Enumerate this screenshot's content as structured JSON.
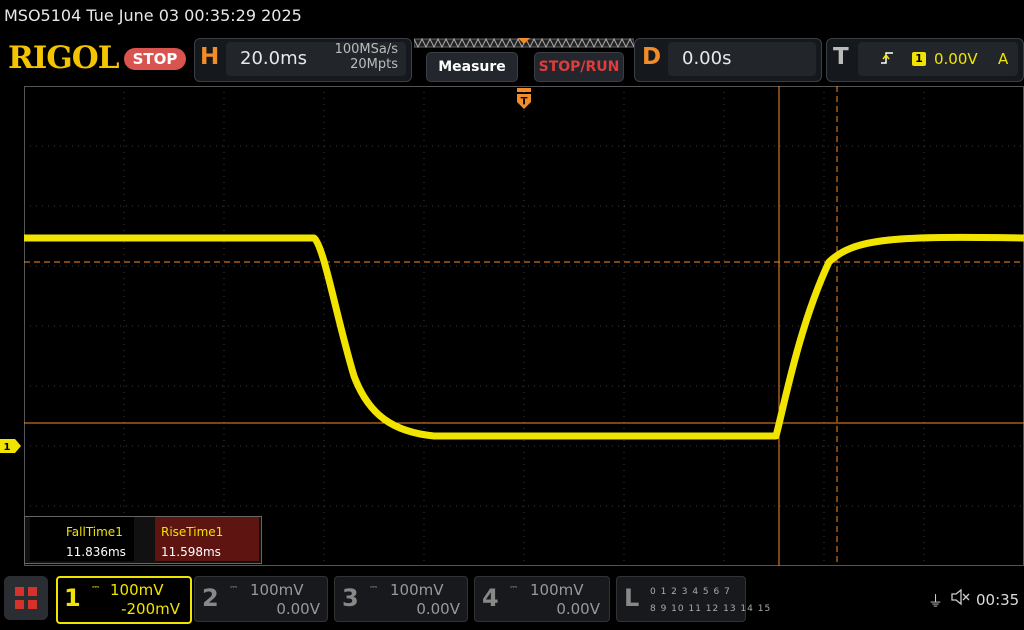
{
  "title": "MSO5104  Tue June 03 00:35:29 2025",
  "logo": "RIGOL",
  "run_state": "STOP",
  "horizontal": {
    "letter": "H",
    "timebase": "20.0ms",
    "sample_rate": "100MSa/s",
    "memory_depth": "20Mpts"
  },
  "buttons": {
    "measure": "Measure",
    "stop_run": "STOP/RUN"
  },
  "delay": {
    "letter": "D",
    "value": "0.00s"
  },
  "trigger": {
    "letter": "T",
    "source": "1",
    "level": "0.00V",
    "mode": "A"
  },
  "channel_marker": "1",
  "measurements": [
    {
      "name": "FallTime1",
      "value": "11.836ms"
    },
    {
      "name": "RiseTime1",
      "value": "11.598ms"
    }
  ],
  "channels": [
    {
      "num": "1",
      "scale": "100mV",
      "offset": "-200mV",
      "color": "#f1e400",
      "active": true
    },
    {
      "num": "2",
      "scale": "100mV",
      "offset": "0.00V",
      "color": "#888888",
      "active": false
    },
    {
      "num": "3",
      "scale": "100mV",
      "offset": "0.00V",
      "color": "#888888",
      "active": false
    },
    {
      "num": "4",
      "scale": "100mV",
      "offset": "0.00V",
      "color": "#888888",
      "active": false
    }
  ],
  "la": {
    "letter": "L",
    "row1": "0 1 2 3   4 5 6 7",
    "row2": "8 9 10 11  12 13 14 15"
  },
  "clock": "00:35",
  "colors": {
    "trace": "#f1e400",
    "cursor": "#f28c28",
    "grid": "#3c3c3c",
    "accent": "#f28c28"
  },
  "icons": {
    "home": "grid-menu-icon",
    "usb": "usb-icon",
    "sound": "speaker-muted-icon",
    "trigger_edge": "rising-edge-icon"
  }
}
